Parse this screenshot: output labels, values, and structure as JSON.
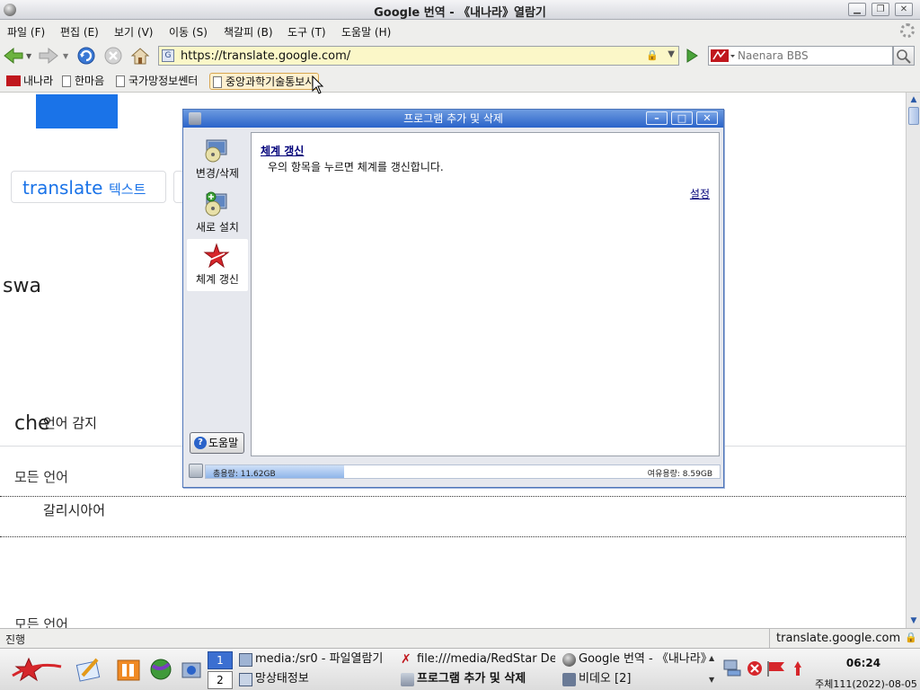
{
  "window": {
    "title": "Google 번역 - 《내나라》열람기"
  },
  "menu": {
    "items": [
      "파일 (F)",
      "편집 (E)",
      "보기 (V)",
      "이동 (S)",
      "책갈피 (B)",
      "도구 (T)",
      "도움말 (H)"
    ]
  },
  "navbar": {
    "url": "https://translate.google.com/",
    "search_placeholder": "Naenara BBS"
  },
  "bookmarks": {
    "items": [
      "내나라",
      "한마음",
      "국가망정보쎈터",
      "중앙과학기술통보사"
    ]
  },
  "page": {
    "translate_title": "translate",
    "text_tab": "텍스트",
    "swap_fragment": "swa",
    "check_fragment": "che",
    "detect_language": "언어 감지",
    "all_languages": "모든 언어",
    "galician": "갈리시아어",
    "all_languages_2": "모든 언어"
  },
  "statusbar": {
    "status": "진행",
    "host": "translate.google.com"
  },
  "dialog": {
    "title": "프로그램 추가 및 삭제",
    "sidebar": [
      {
        "label": "변경/삭제",
        "icon": "cd-computer-icon"
      },
      {
        "label": "새로 설치",
        "icon": "install-disc-icon"
      },
      {
        "label": "체계 갱신",
        "icon": "red-star-icon"
      }
    ],
    "help_button": "도움말",
    "panel_heading": "체계 갱신",
    "panel_description": "우의 항목을 누르면 체계를 갱신합니다.",
    "settings_link": "설정",
    "disk_used": "총용량: 11.62GB",
    "disk_free": "여유용량: 8.59GB",
    "disk_used_fraction": 0.27
  },
  "taskbar": {
    "desktops": [
      "1",
      "2"
    ],
    "tasks": [
      {
        "label": "media:/sr0 - 파일열람기",
        "icon": "file-manager-icon"
      },
      {
        "label": "file:///media/RedStar De",
        "icon": "file-x-icon"
      },
      {
        "label": "Google 번역 - 《내나라》",
        "icon": "browser-icon"
      },
      {
        "label": "망상태정보",
        "icon": "network-status-icon"
      },
      {
        "label": "프로그램 추가 및 삭제",
        "icon": "install-icon"
      },
      {
        "label": "비데오 [2]",
        "icon": "video-icon"
      }
    ],
    "time": "06:24",
    "date": "주체111(2022)-08-05"
  },
  "colors": {
    "title_gradient_top": "#6d9be0",
    "title_gradient_bottom": "#2a63c9",
    "url_bg": "#fbf7c8",
    "google_blue": "#1a73e8",
    "redstar": "#c0171d"
  }
}
